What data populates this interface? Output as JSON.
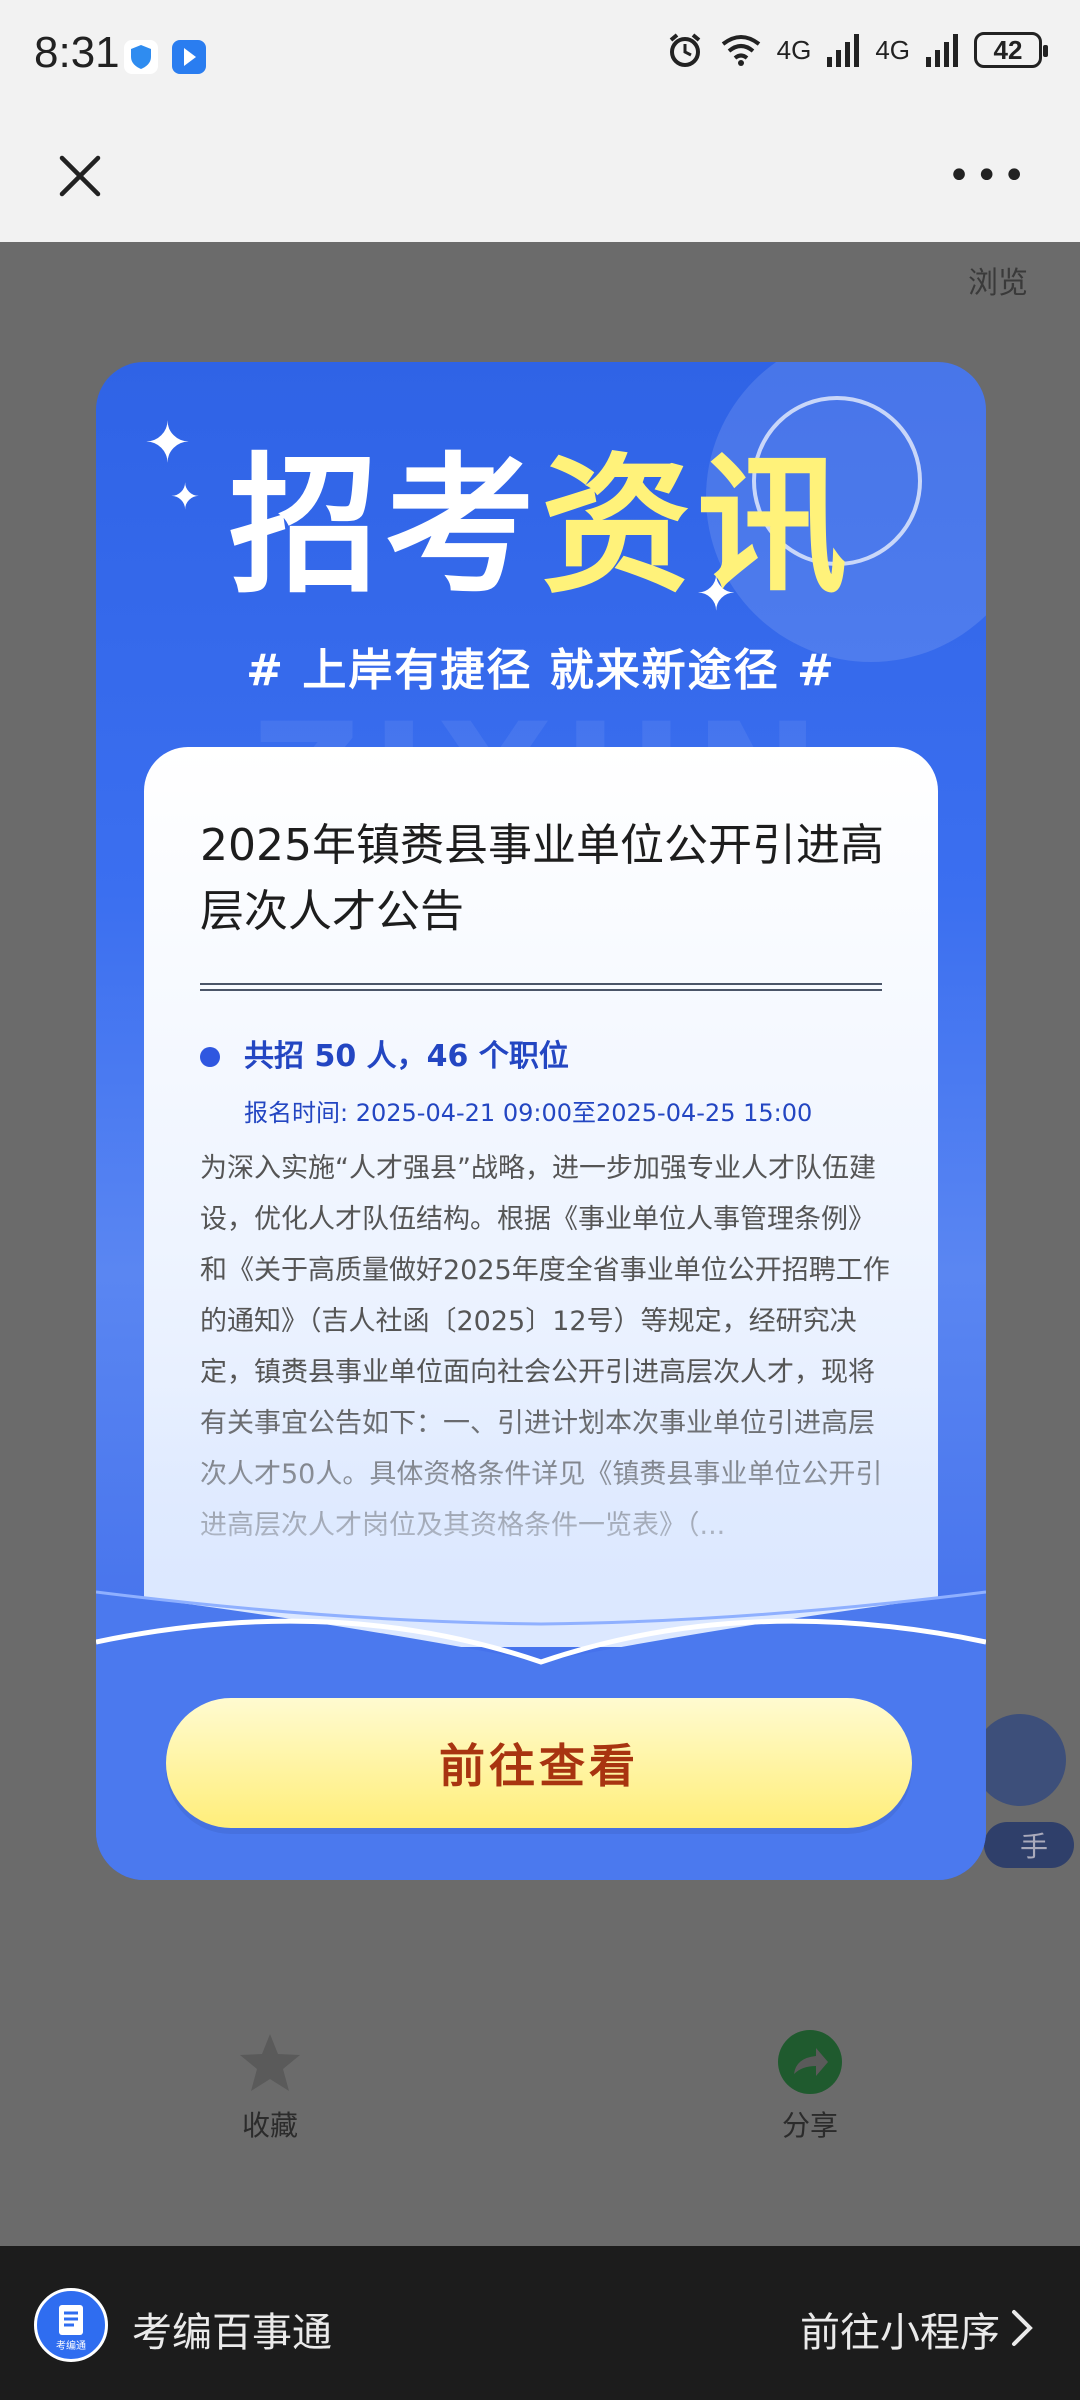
{
  "status_bar": {
    "time": "8:31",
    "network_labels": [
      "4G",
      "4G"
    ],
    "battery": "42"
  },
  "background_page": {
    "browse_label": "浏览",
    "actions": [
      {
        "label": "收藏",
        "icon": "star-icon"
      },
      {
        "label": "分享",
        "icon": "share-icon"
      }
    ],
    "helper_partial": "手"
  },
  "popup": {
    "title_white": "招考",
    "title_yellow": "资讯",
    "slogan": "# 上岸有捷径 就来新途径 #",
    "watermark": "ZIXUN",
    "card": {
      "title": "2025年镇赉县事业单位公开引进高层次人才公告",
      "highlight": "共招 50 人，46 个职位",
      "registration": "报名时间: 2025-04-21 09:00至2025-04-25 15:00",
      "body": "为深入实施“人才强县”战略，进一步加强专业人才队伍建设，优化人才队伍结构。根据《事业单位人事管理条例》和《关于高质量做好2025年度全省事业单位公开招聘工作的通知》（吉人社函〔2025〕12号）等规定，经研究决定，镇赉县事业单位面向社会公开引进高层次人才，现将有关事宜公告如下：一、引进计划本次事业单位引进高层次人才50人。具体资格条件详见《镇赉县事业单位公开引进高层次人才岗位及其资格条件一览表》（..."
    },
    "button_label": "前往查看"
  },
  "mini_program_bar": {
    "name": "考编百事通",
    "goto_label": "前往小程序",
    "logo_caption": "考编通"
  },
  "colors": {
    "popup_blue": "#3a6cf0",
    "title_yellow": "#fff27a",
    "button_text": "#a83410",
    "bottom_bar": "#1c1c1c"
  }
}
